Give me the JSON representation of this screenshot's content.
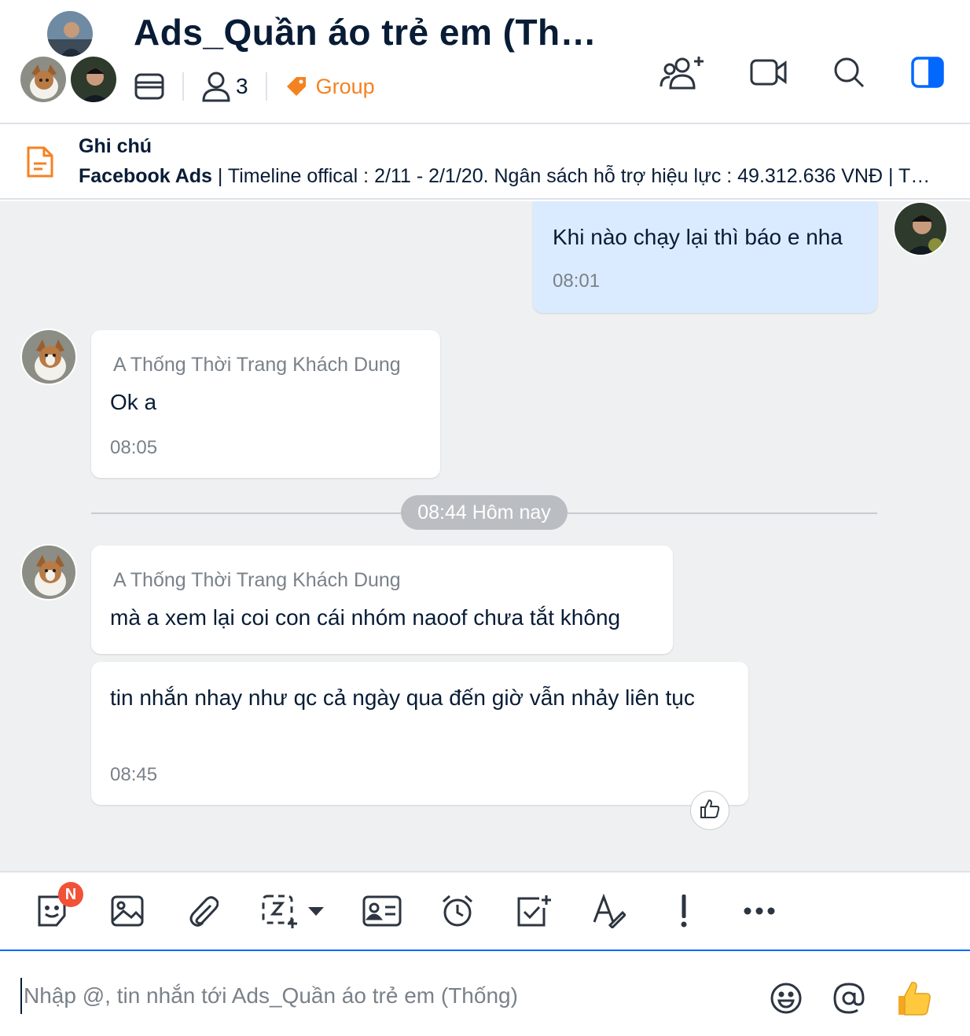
{
  "header": {
    "title": "Ads_Quần áo trẻ em (Th…",
    "member_count": "3",
    "group_label": "Group",
    "icons": [
      "add-member-icon",
      "video-call-icon",
      "search-icon",
      "sidebar-toggle-icon"
    ]
  },
  "pinned_note": {
    "title": "Ghi chú",
    "bold_prefix": "Facebook Ads",
    "body": " | Timeline offical : 2/11 - 2/1/20. Ngân sách hỗ trợ hiệu lực : 49.312.636 VNĐ | T…"
  },
  "messages": [
    {
      "mine": true,
      "text": "Khi nào chạy lại thì báo e nha",
      "time": "08:01"
    },
    {
      "mine": false,
      "sender": "A Thống Thời Trang Khách Dung",
      "text": "Ok a",
      "time": "08:05"
    },
    {
      "mine": false,
      "sender": "A Thống Thời Trang Khách Dung",
      "text": "mà a xem lại coi con cái nhóm naoof chưa tắt không"
    },
    {
      "mine": false,
      "text": "tin nhắn nhay như qc cả ngày qua đến giờ vẫn nhảy liên tục",
      "time": "08:45"
    }
  ],
  "date_divider": "08:44 Hôm nay",
  "toolbar": {
    "sticker_badge": "N",
    "icons": [
      "sticker-icon",
      "image-icon",
      "attachment-icon",
      "screenshot-icon",
      "contact-card-icon",
      "reminder-icon",
      "task-icon",
      "text-format-icon",
      "urgent-icon",
      "more-icon"
    ]
  },
  "composer": {
    "placeholder": "Nhập @, tin nhắn tới Ads_Quần áo trẻ em (Thống)",
    "value": ""
  },
  "colors": {
    "accent": "#0068ff",
    "group_tag": "#f58220",
    "my_bubble": "#dbebff",
    "chat_bg": "#eef0f1",
    "badge": "#f25138"
  }
}
